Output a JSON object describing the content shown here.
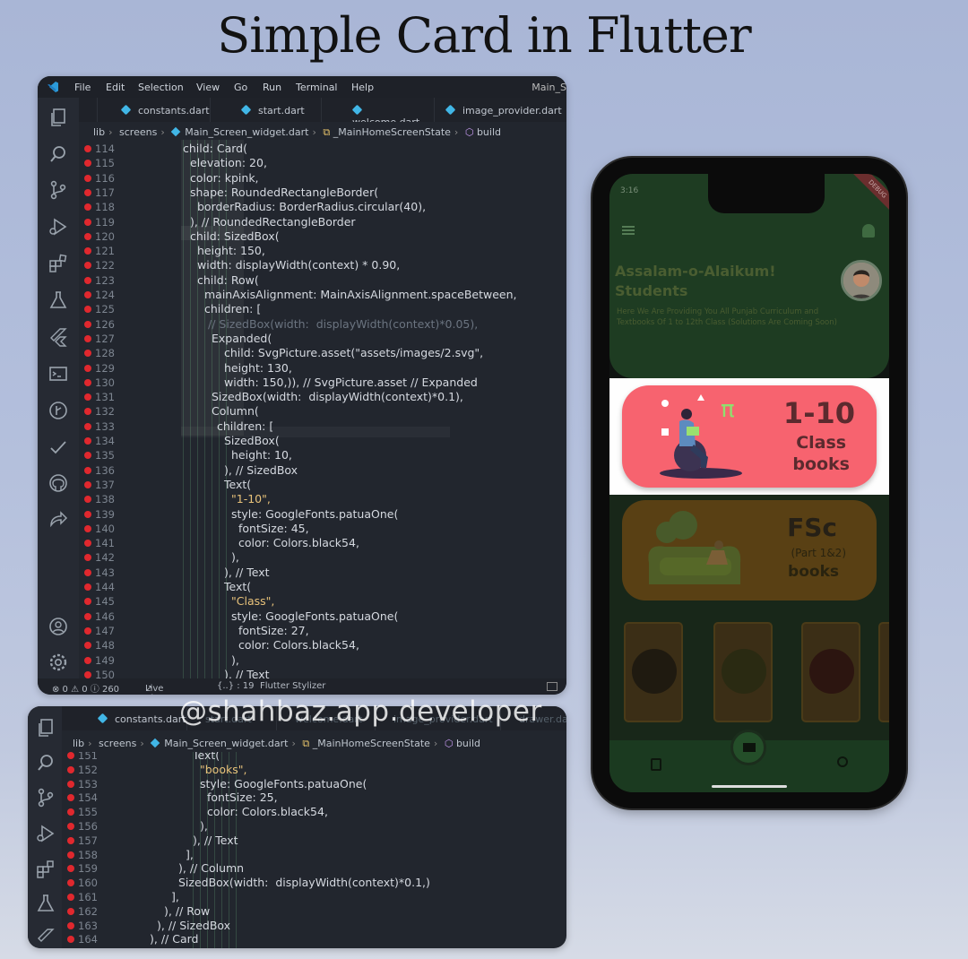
{
  "title": "Simple Card in Flutter",
  "watermark": "@shahbaz.app.developer",
  "editor1": {
    "menu": [
      "File",
      "Edit",
      "Selection",
      "View",
      "Go",
      "Run",
      "Terminal",
      "Help"
    ],
    "window_title": "Main_S",
    "tabs": [
      "constants.dart",
      "start.dart",
      "welcome.dart",
      "image_provider.dart"
    ],
    "breadcrumb": [
      "lib",
      "screens",
      "Main_Screen_widget.dart",
      "_MainHomeScreenState",
      "build"
    ],
    "status": {
      "problems": "⊗ 0 ⚠ 0 ⓘ 260",
      "live_share": "Live Share",
      "position": "{..} : 19",
      "stylizer": "Flutter Stylizer"
    },
    "lines": [
      {
        "n": "114",
        "t": "child: Card("
      },
      {
        "n": "115",
        "t": "elevation: 20,"
      },
      {
        "n": "116",
        "t": "color: kpink,"
      },
      {
        "n": "117",
        "t": "shape: RoundedRectangleBorder("
      },
      {
        "n": "118",
        "t": "borderRadius: BorderRadius.circular(40),"
      },
      {
        "n": "119",
        "t": "), // RoundedRectangleBorder"
      },
      {
        "n": "120",
        "t": "child: SizedBox("
      },
      {
        "n": "121",
        "t": "height: 150,"
      },
      {
        "n": "122",
        "t": "width: displayWidth(context) * 0.90,"
      },
      {
        "n": "123",
        "t": "child: Row("
      },
      {
        "n": "124",
        "t": "mainAxisAlignment: MainAxisAlignment.spaceBetween,"
      },
      {
        "n": "125",
        "t": "children: ["
      },
      {
        "n": "126",
        "t": "// SizedBox(width:  displayWidth(context)*0.05),"
      },
      {
        "n": "127",
        "t": "Expanded("
      },
      {
        "n": "128",
        "t": "child: SvgPicture.asset(\"assets/images/2.svg\","
      },
      {
        "n": "129",
        "t": "height: 130,"
      },
      {
        "n": "130",
        "t": "width: 150,)), // SvgPicture.asset // Expanded"
      },
      {
        "n": "131",
        "t": "SizedBox(width:  displayWidth(context)*0.1),"
      },
      {
        "n": "132",
        "t": "Column("
      },
      {
        "n": "133",
        "t": "children: ["
      },
      {
        "n": "134",
        "t": "SizedBox("
      },
      {
        "n": "135",
        "t": "height: 10,"
      },
      {
        "n": "136",
        "t": "), // SizedBox"
      },
      {
        "n": "137",
        "t": "Text("
      },
      {
        "n": "138",
        "t": "\"1-10\","
      },
      {
        "n": "139",
        "t": "style: GoogleFonts.patuaOne("
      },
      {
        "n": "140",
        "t": "fontSize: 45,"
      },
      {
        "n": "141",
        "t": "color: Colors.black54,"
      },
      {
        "n": "142",
        "t": "),"
      },
      {
        "n": "143",
        "t": "), // Text"
      },
      {
        "n": "144",
        "t": "Text("
      },
      {
        "n": "145",
        "t": "\"Class\","
      },
      {
        "n": "146",
        "t": "style: GoogleFonts.patuaOne("
      },
      {
        "n": "147",
        "t": "fontSize: 27,"
      },
      {
        "n": "148",
        "t": "color: Colors.black54,"
      },
      {
        "n": "149",
        "t": "),"
      },
      {
        "n": "150",
        "t": "), // Text"
      }
    ]
  },
  "editor2": {
    "tabs": [
      "constants.dart",
      "start.dart",
      "welcome.dart",
      "image_provider.dart",
      "drawer.dart"
    ],
    "breadcrumb": [
      "lib",
      "screens",
      "Main_Screen_widget.dart",
      "_MainHomeScreenState",
      "build"
    ],
    "lines": [
      {
        "n": "151",
        "t": "Text("
      },
      {
        "n": "152",
        "t": "\"books\","
      },
      {
        "n": "153",
        "t": "style: GoogleFonts.patuaOne("
      },
      {
        "n": "154",
        "t": "fontSize: 25,"
      },
      {
        "n": "155",
        "t": "color: Colors.black54,"
      },
      {
        "n": "156",
        "t": "),"
      },
      {
        "n": "157",
        "t": "), // Text"
      },
      {
        "n": "158",
        "t": "],"
      },
      {
        "n": "159",
        "t": "), // Column"
      },
      {
        "n": "160",
        "t": "SizedBox(width:  displayWidth(context)*0.1,)"
      },
      {
        "n": "161",
        "t": "],"
      },
      {
        "n": "162",
        "t": "), // Row"
      },
      {
        "n": "163",
        "t": "), // SizedBox"
      },
      {
        "n": "164",
        "t": "), // Card"
      }
    ]
  },
  "phone": {
    "status_time": "3:16",
    "debug_badge": "DEBUG",
    "greeting": "Assalam-o-Alaikum! Students",
    "subtitle": "Here We Are Providing You All Punjab Curriculum and Textbooks Of 1 to 12th Class (Solutions Are Coming Soon)",
    "card1": {
      "big": "1-10",
      "line1": "Class",
      "line2": "books",
      "symbol": "π",
      "color": "#f7636f"
    },
    "card2": {
      "big": "FSc",
      "line1": "(Part 1&2)",
      "line2": "books"
    }
  }
}
